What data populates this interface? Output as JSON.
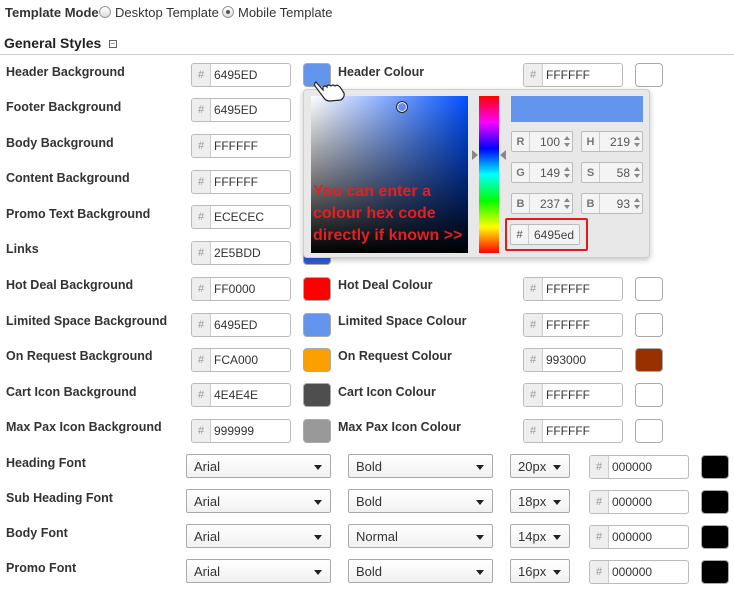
{
  "template_mode": {
    "label": "Template Mode",
    "options": [
      {
        "label": "Desktop Template",
        "selected": false
      },
      {
        "label": "Mobile Template",
        "selected": true
      }
    ]
  },
  "section": {
    "title": "General Styles",
    "toggle": "⊟"
  },
  "colors": {
    "header_bg": {
      "label": "Header Background",
      "hex": "6495ED",
      "swatch": "#6495ED"
    },
    "header_colour": {
      "label": "Header Colour",
      "hex": "FFFFFF",
      "swatch": "#FFFFFF"
    },
    "footer_bg": {
      "label": "Footer Background",
      "hex": "6495ED"
    },
    "body_bg": {
      "label": "Body Background",
      "hex": "FFFFFF"
    },
    "content_bg": {
      "label": "Content Background",
      "hex": "FFFFFF"
    },
    "promo_bg": {
      "label": "Promo Text Background",
      "hex": "ECECEC"
    },
    "links": {
      "label": "Links",
      "hex": "2E5BDD"
    },
    "hotdeal_bg": {
      "label": "Hot Deal Background",
      "hex": "FF0000",
      "swatch": "#FF0000"
    },
    "hotdeal_colour": {
      "label": "Hot Deal Colour",
      "hex": "FFFFFF",
      "swatch": "#FFFFFF"
    },
    "limited_bg": {
      "label": "Limited Space Background",
      "hex": "6495ED",
      "swatch": "#6495ED"
    },
    "limited_colour": {
      "label": "Limited Space Colour",
      "hex": "FFFFFF",
      "swatch": "#FFFFFF"
    },
    "onrequest_bg": {
      "label": "On Request Background",
      "hex": "FCA000",
      "swatch": "#FCA000"
    },
    "onrequest_colour": {
      "label": "On Request Colour",
      "hex": "993000",
      "swatch": "#993000"
    },
    "cart_bg": {
      "label": "Cart Icon Background",
      "hex": "4E4E4E",
      "swatch": "#4E4E4E"
    },
    "cart_colour": {
      "label": "Cart Icon Colour",
      "hex": "FFFFFF",
      "swatch": "#FFFFFF"
    },
    "maxpax_bg": {
      "label": "Max Pax Icon Background",
      "hex": "999999",
      "swatch": "#999999"
    },
    "maxpax_colour": {
      "label": "Max Pax Icon Colour",
      "hex": "FFFFFF",
      "swatch": "#FFFFFF"
    }
  },
  "fonts": [
    {
      "label": "Heading Font",
      "family": "Arial",
      "weight": "Bold",
      "size": "20px",
      "hex": "000000"
    },
    {
      "label": "Sub Heading Font",
      "family": "Arial",
      "weight": "Bold",
      "size": "18px",
      "hex": "000000"
    },
    {
      "label": "Body Font",
      "family": "Arial",
      "weight": "Normal",
      "size": "14px",
      "hex": "000000"
    },
    {
      "label": "Promo Font",
      "family": "Arial",
      "weight": "Bold",
      "size": "16px",
      "hex": "000000"
    }
  ],
  "picker": {
    "R": "100",
    "G": "149",
    "B": "237",
    "H": "219",
    "S": "58",
    "B2": "93",
    "hash": "#",
    "hex": "6495ed",
    "labels": {
      "r": "R",
      "g": "G",
      "b": "B",
      "h": "H",
      "s": "S",
      "b2": "B"
    }
  },
  "annotation": "You can enter a colour hex code directly if known >>",
  "hash_symbol": "#"
}
